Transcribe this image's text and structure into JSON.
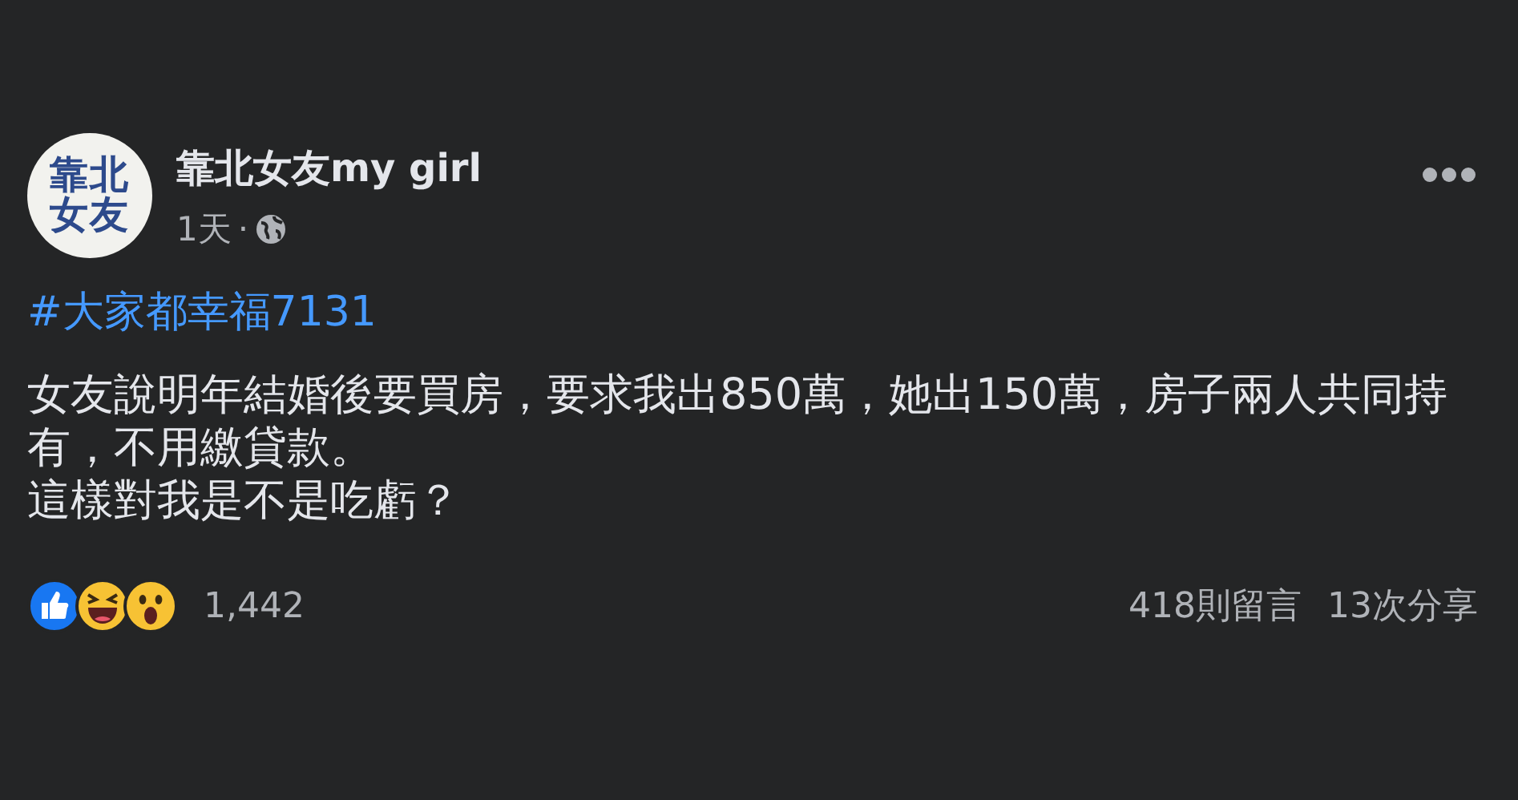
{
  "post": {
    "avatar": {
      "lines": [
        "靠北",
        "女友"
      ]
    },
    "author": "靠北女友my girl",
    "time": "1天",
    "separator": "·",
    "hashtag": "#大家都幸福7131",
    "paragraphs": [
      "女友說明年結婚後要買房，要求我出850萬，她出150萬，房子兩人共同持有，不用繳貸款。",
      "這樣對我是不是吃虧？"
    ],
    "reactions": {
      "count": "1,442",
      "items": [
        {
          "kind": "like"
        },
        {
          "kind": "haha"
        },
        {
          "kind": "wow"
        }
      ]
    },
    "comments": "418則留言",
    "shares": "13次分享"
  }
}
